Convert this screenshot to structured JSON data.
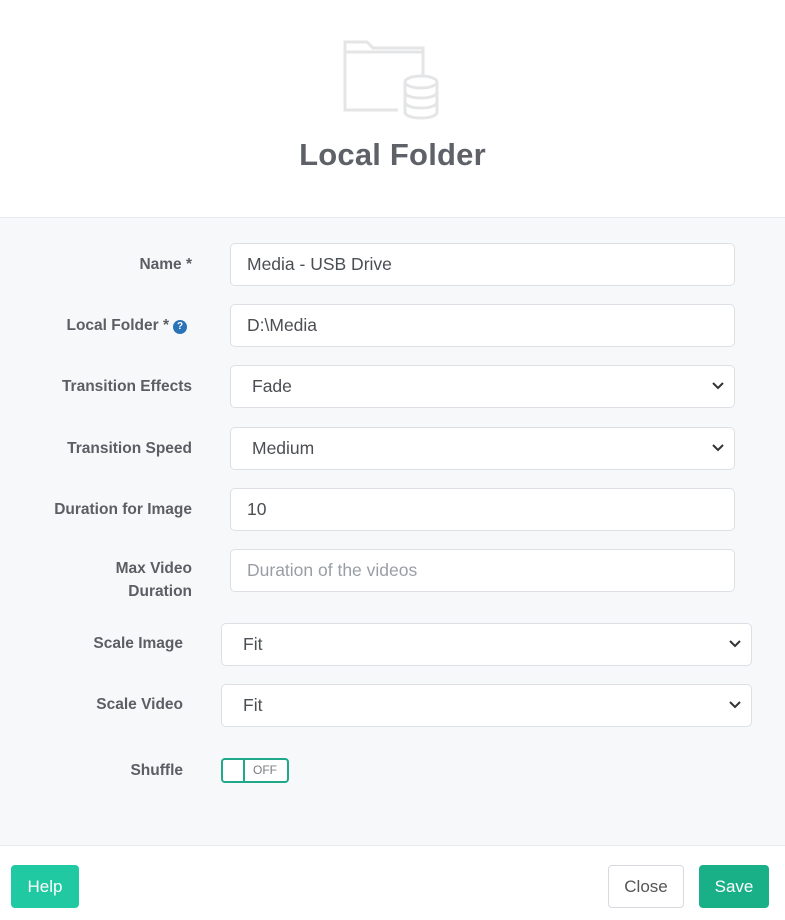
{
  "header": {
    "icon": "folder-database-icon",
    "title": "Local Folder"
  },
  "form": {
    "name": {
      "label": "Name *",
      "value": "Media - USB Drive"
    },
    "local_folder": {
      "label": "Local Folder *",
      "help_icon": "question-circle-icon",
      "help_glyph": "?",
      "value": "D:\\Media"
    },
    "transition_effects": {
      "label": "Transition Effects",
      "value": "Fade"
    },
    "transition_speed": {
      "label": "Transition Speed",
      "value": "Medium"
    },
    "duration_image": {
      "label": "Duration for Image",
      "value": "10"
    },
    "max_video": {
      "label_line1": "Max Video",
      "label_line2": "Duration",
      "placeholder": "Duration of the videos"
    },
    "scale_image": {
      "label": "Scale Image",
      "value": "Fit"
    },
    "scale_video": {
      "label": "Scale Video",
      "value": "Fit"
    },
    "shuffle": {
      "label": "Shuffle",
      "state": "OFF"
    }
  },
  "footer": {
    "help_label": "Help",
    "close_label": "Close",
    "save_label": "Save"
  },
  "colors": {
    "accent_help": "#20c9a1",
    "accent_save": "#19b088",
    "toggle_border": "#1fa88a",
    "info_icon": "#2b73b8"
  }
}
